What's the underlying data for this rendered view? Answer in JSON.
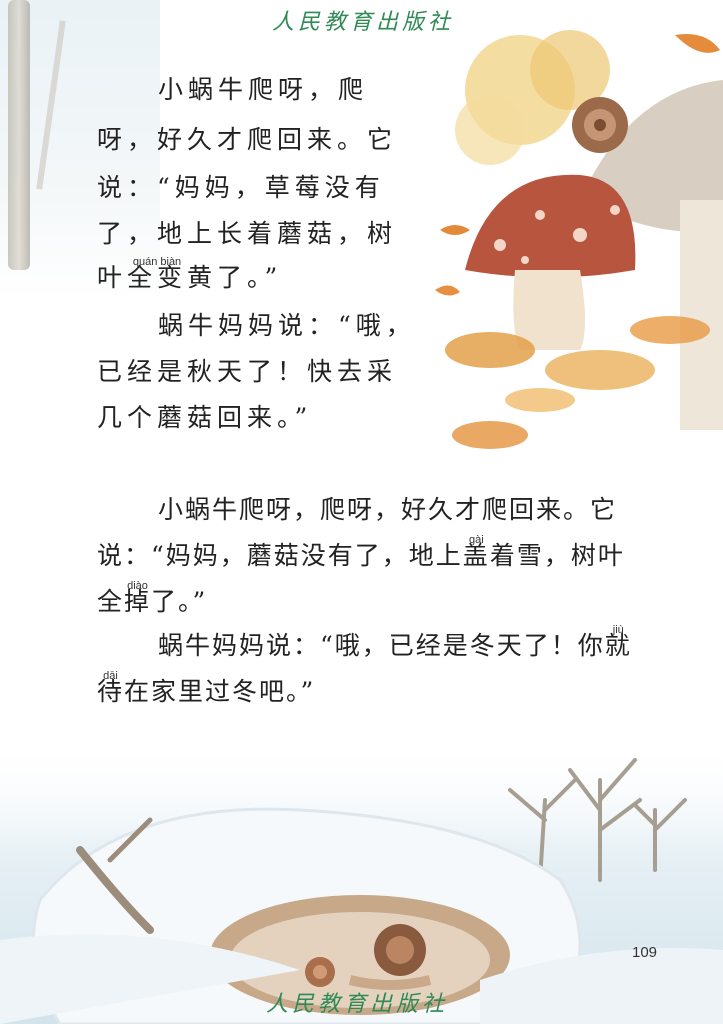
{
  "publisher": "人民教育出版社",
  "page_number": "109",
  "autumn_passage": {
    "lines": [
      "小蜗牛爬呀，爬",
      "呀，好久才爬回来。它",
      "说：“妈妈，草莓没有",
      "了，地上长着蘑菇，树"
    ],
    "line5_pre": "叶",
    "line5_ruby_pinyin": "quán biàn",
    "line5_ruby_text": "全变",
    "line5_post": "黄了。”",
    "reply_lines": [
      "蜗牛妈妈说：“哦，",
      "已经是秋天了！快去采",
      "几个蘑菇回来。”"
    ]
  },
  "winter_passage": {
    "line1": "小蜗牛爬呀，爬呀，好久才爬回来。它",
    "line2_pre": "说：“妈妈，蘑菇没有了，地上",
    "line2_ruby_pinyin": "gài",
    "line2_ruby_text": "盖",
    "line2_post": "着雪，树叶",
    "line3_pre": "全",
    "line3_ruby_pinyin": "diào",
    "line3_ruby_text": "掉",
    "line3_post": "了。”",
    "line4_pre": "蜗牛妈妈说：“哦，已经是冬天了！你",
    "line4_ruby_pinyin": "jiù",
    "line4_ruby_text": "就",
    "line5_ruby_pinyin": "dāi",
    "line5_ruby_text": "待",
    "line5_post": "在家里过冬吧。”"
  },
  "colors": {
    "publisher_green": "#2f8a55",
    "mushroom_red": "#b8553e",
    "leaf_orange": "#e3a04a"
  }
}
